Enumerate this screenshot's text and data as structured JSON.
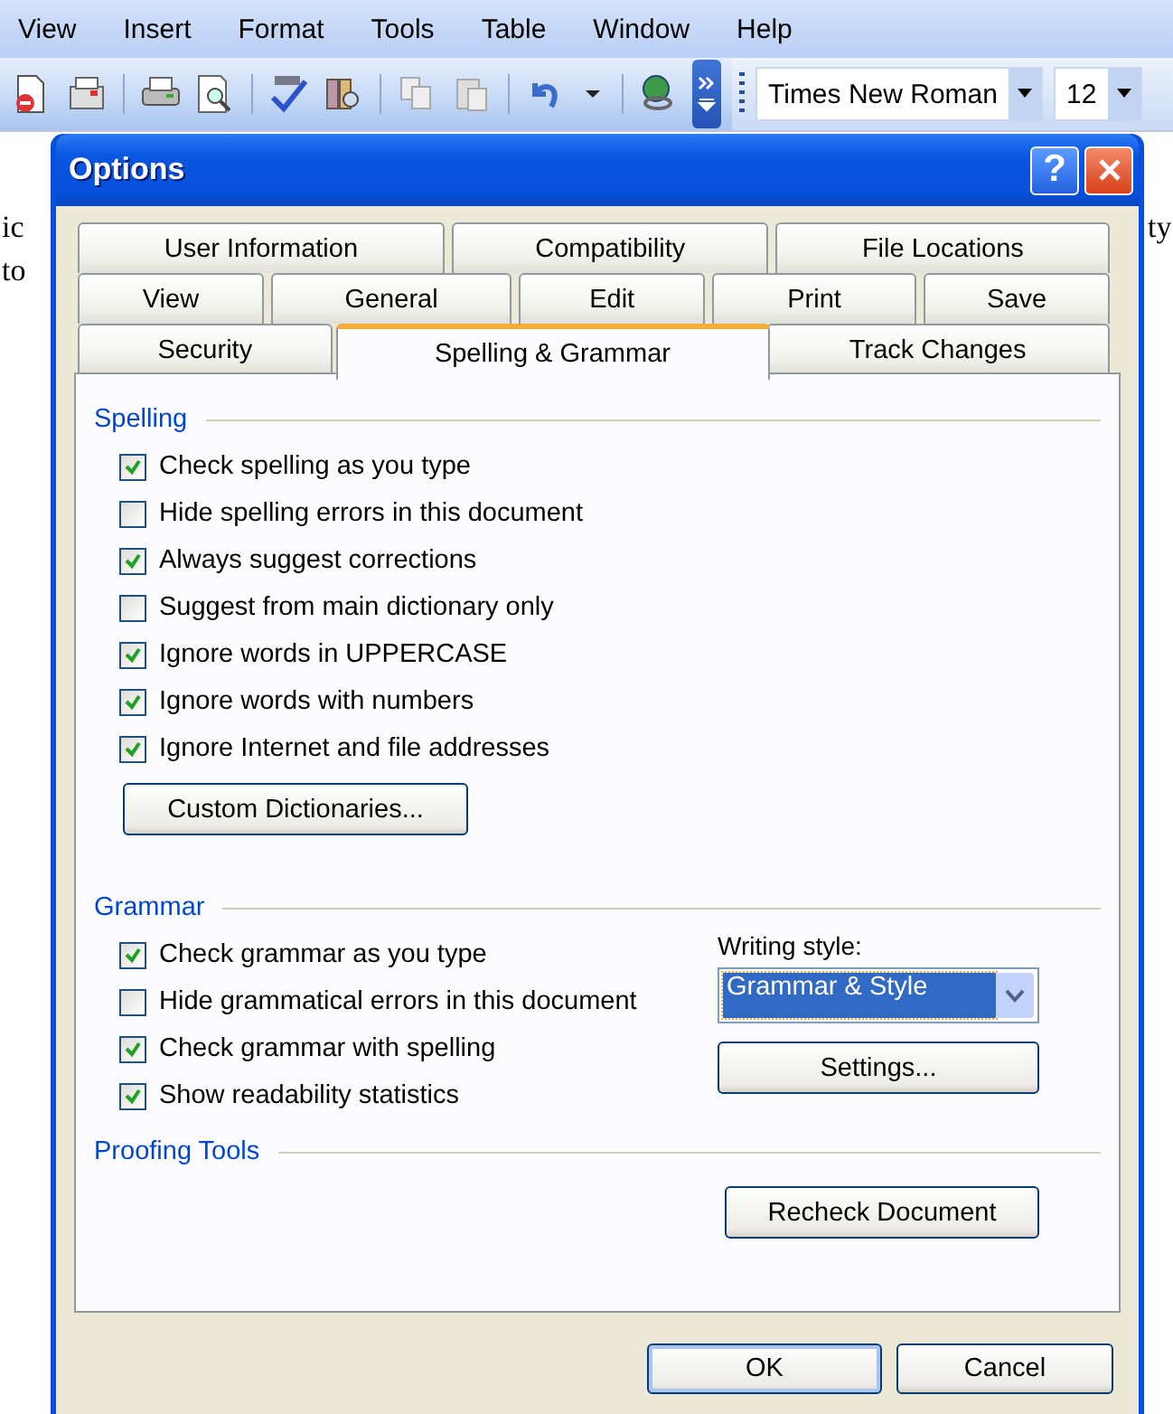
{
  "menu_bar": [
    {
      "label": "View"
    },
    {
      "label": "Insert"
    },
    {
      "label": "Format"
    },
    {
      "label": "Tools"
    },
    {
      "label": "Table"
    },
    {
      "label": "Window"
    },
    {
      "label": "Help"
    }
  ],
  "toolbar": {
    "font_name": "Times New Roman",
    "font_size": "12"
  },
  "document": {
    "left_fragments": [
      "ic",
      "to"
    ],
    "right_fragments": [
      "ty"
    ]
  },
  "dialog": {
    "title": "Options",
    "help_button": "?",
    "tab_rows": [
      [
        {
          "label": "User Information",
          "selected": false
        },
        {
          "label": "Compatibility",
          "selected": false
        },
        {
          "label": "File Locations",
          "selected": false
        }
      ],
      [
        {
          "label": "View",
          "selected": false
        },
        {
          "label": "General",
          "selected": false
        },
        {
          "label": "Edit",
          "selected": false
        },
        {
          "label": "Print",
          "selected": false
        },
        {
          "label": "Save",
          "selected": false
        }
      ],
      [
        {
          "label": "Security",
          "selected": false
        },
        {
          "label": "Spelling & Grammar",
          "selected": true
        },
        {
          "label": "Track Changes",
          "selected": false
        }
      ]
    ],
    "spelling": {
      "title": "Spelling",
      "options": [
        {
          "label": "Check spelling as you type",
          "checked": true
        },
        {
          "label": "Hide spelling errors in this document",
          "checked": false
        },
        {
          "label": "Always suggest corrections",
          "checked": true
        },
        {
          "label": "Suggest from main dictionary only",
          "checked": false
        },
        {
          "label": "Ignore words in UPPERCASE",
          "checked": true
        },
        {
          "label": "Ignore words with numbers",
          "checked": true
        },
        {
          "label": "Ignore Internet and file addresses",
          "checked": true
        }
      ],
      "button": "Custom Dictionaries..."
    },
    "grammar": {
      "title": "Grammar",
      "options": [
        {
          "label": "Check grammar as you type",
          "checked": true
        },
        {
          "label": "Hide grammatical errors in this document",
          "checked": false
        },
        {
          "label": "Check grammar with spelling",
          "checked": true
        },
        {
          "label": "Show readability statistics",
          "checked": true
        }
      ],
      "writing_style": {
        "label": "Writing style:",
        "value": "Grammar & Style"
      },
      "button": "Settings..."
    },
    "proofing": {
      "title": "Proofing Tools",
      "button": "Recheck Document"
    },
    "buttons": [
      {
        "label": "OK",
        "default": true
      },
      {
        "label": "Cancel",
        "default": false
      }
    ]
  }
}
